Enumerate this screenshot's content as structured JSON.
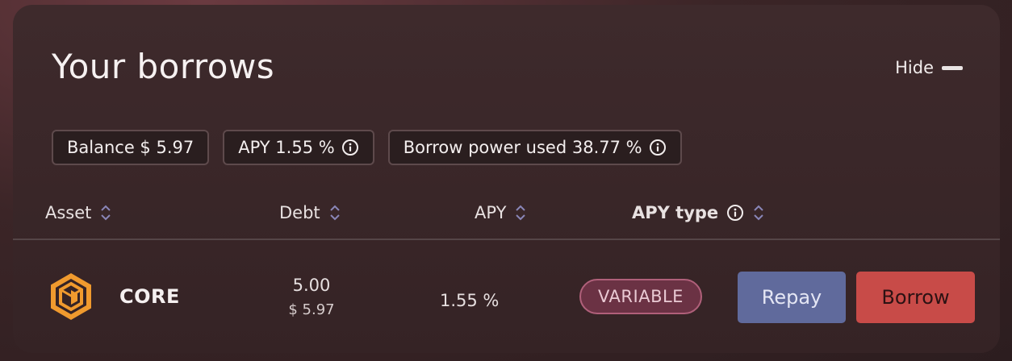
{
  "card": {
    "title": "Your borrows",
    "hide_label": "Hide"
  },
  "summary": {
    "balance": "Balance $ 5.97",
    "apy": "APY 1.55 %",
    "borrow_power": "Borrow power used 38.77 %"
  },
  "table": {
    "headers": {
      "asset": "Asset",
      "debt": "Debt",
      "apy": "APY",
      "apy_type": "APY type"
    },
    "rows": [
      {
        "asset": "CORE",
        "debt_amount": "5.00",
        "debt_usd": "$ 5.97",
        "apy": "1.55 %",
        "apy_type": "VARIABLE",
        "repay_label": "Repay",
        "borrow_label": "Borrow"
      }
    ]
  },
  "colors": {
    "repay_button": "#606a9c",
    "borrow_button": "#c84b48",
    "badge": "#6b3244",
    "core_icon": "#f09a2e"
  },
  "icons": {
    "hide": "minus-icon",
    "info": "info-icon",
    "sort": "sort-icon",
    "asset": "core-logo-icon"
  }
}
